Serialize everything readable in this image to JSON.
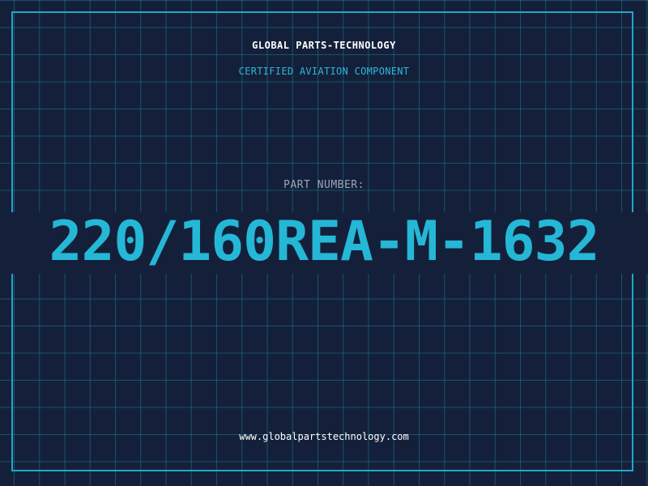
{
  "header": {
    "brand": "GLOBAL PARTS-TECHNOLOGY",
    "subtitle": "CERTIFIED AVIATION COMPONENT"
  },
  "main": {
    "label": "PART NUMBER:",
    "part_number": "220/160REA-M-1632"
  },
  "footer": {
    "url": "www.globalpartstechnology.com"
  },
  "colors": {
    "background": "#14203a",
    "grid": "#1e7896",
    "accent": "#25b7d6",
    "frame": "#1fa8c8",
    "label": "#9aa6b8",
    "text": "#ffffff"
  }
}
